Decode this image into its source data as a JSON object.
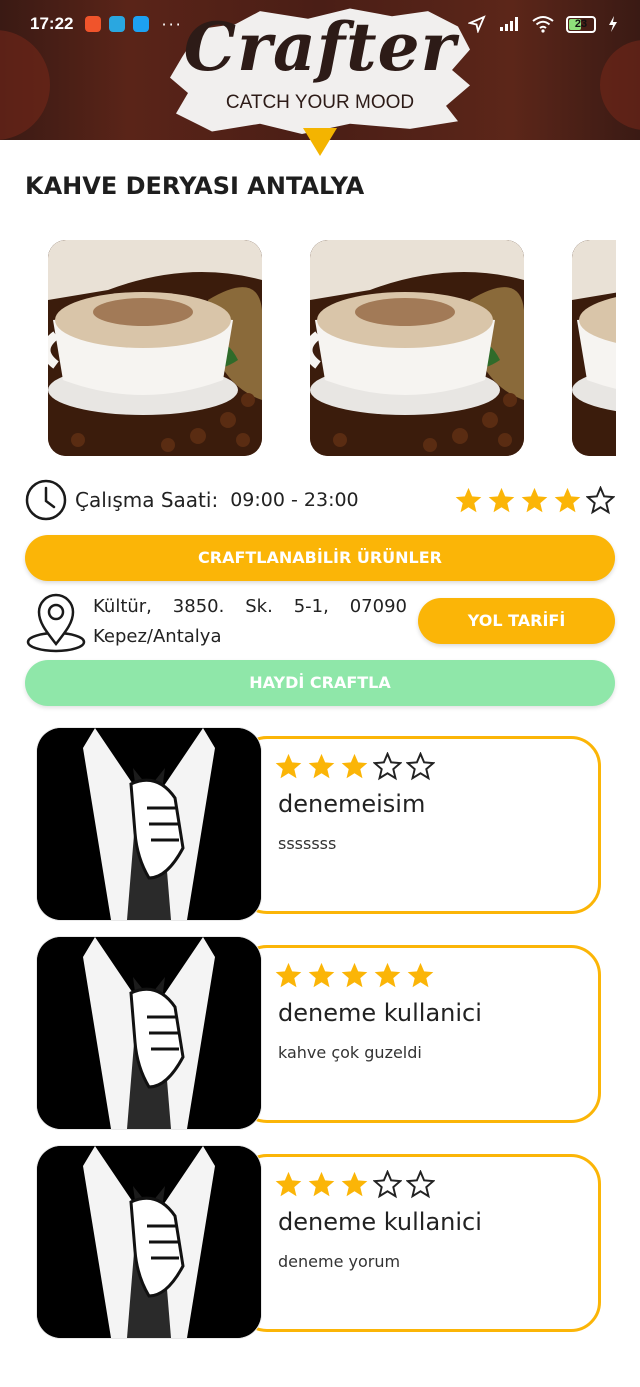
{
  "status_bar": {
    "time": "17:22",
    "dots": "···",
    "battery": "23"
  },
  "header": {
    "logo": "Crafter",
    "tagline": "CATCH YOUR MOOD"
  },
  "place": {
    "title": "KAHVE DERYASI ANTALYA",
    "hours_label": "Çalışma Saati:",
    "hours_value": "09:00 - 23:00",
    "rating": 4,
    "address": "Kültür, 3850. Sk. 5-1, 07090 Kepez/Antalya"
  },
  "buttons": {
    "products": "CRAFTLANABİLİR ÜRÜNLER",
    "directions": "YOL TARİFİ",
    "craft": "HAYDİ CRAFTLA"
  },
  "reviews": [
    {
      "name": "denemeisim",
      "comment": "sssssss",
      "rating": 3
    },
    {
      "name": "deneme kullanici",
      "comment": "kahve çok guzeldi",
      "rating": 5
    },
    {
      "name": "deneme kullanici",
      "comment": "deneme yorum",
      "rating": 3
    }
  ],
  "colors": {
    "accent": "#fbb507",
    "craft_button": "#8fe7a9",
    "header_bg": "#4a1e16"
  },
  "icons": {
    "clock": "clock-icon",
    "location": "location-pin-icon",
    "star_filled": "star-filled-icon",
    "star_empty": "star-outline-icon"
  }
}
